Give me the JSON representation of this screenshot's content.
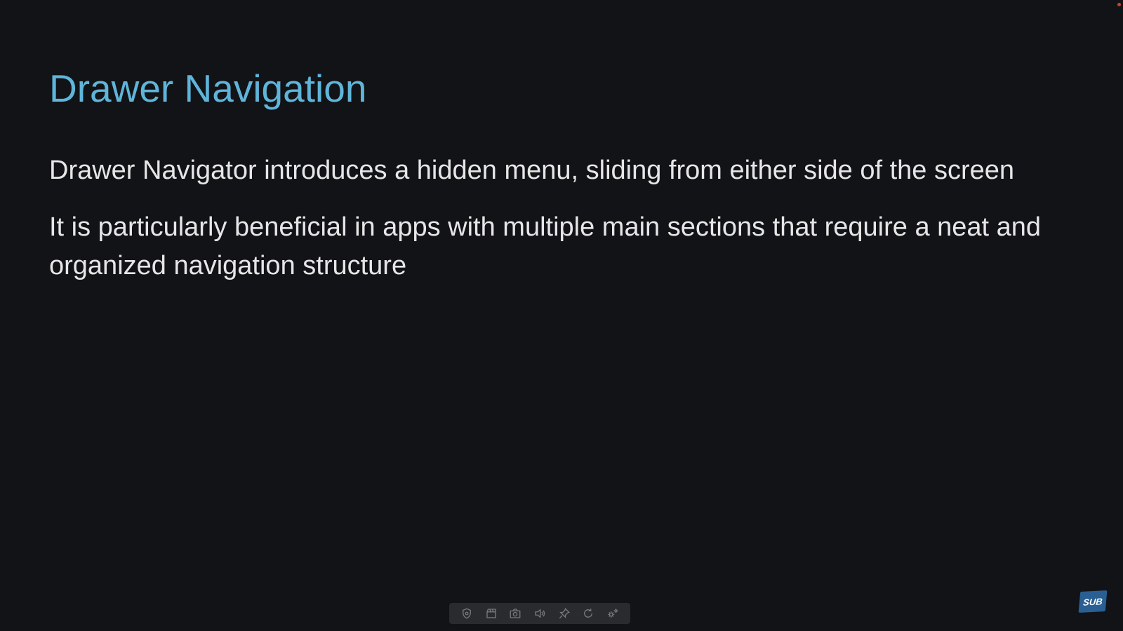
{
  "slide": {
    "title": "Drawer Navigation",
    "bullets": [
      "Drawer Navigator introduces a hidden menu, sliding from either side of the screen",
      "It is particularly beneficial in apps with multiple main sections that require a neat and organized navigation structure"
    ]
  },
  "toolbar": {
    "buttons": [
      {
        "name": "shield-icon"
      },
      {
        "name": "clapperboard-icon"
      },
      {
        "name": "camera-icon"
      },
      {
        "name": "speaker-icon"
      },
      {
        "name": "pin-icon"
      },
      {
        "name": "refresh-icon"
      },
      {
        "name": "settings-icon"
      }
    ]
  },
  "badge": {
    "label": "SUB"
  },
  "colors": {
    "background": "#121317",
    "title": "#5fb5d9",
    "body_text": "#e6e6e6",
    "toolbar_bg": "#2a2b2f",
    "badge_bg": "#2a5f93"
  }
}
